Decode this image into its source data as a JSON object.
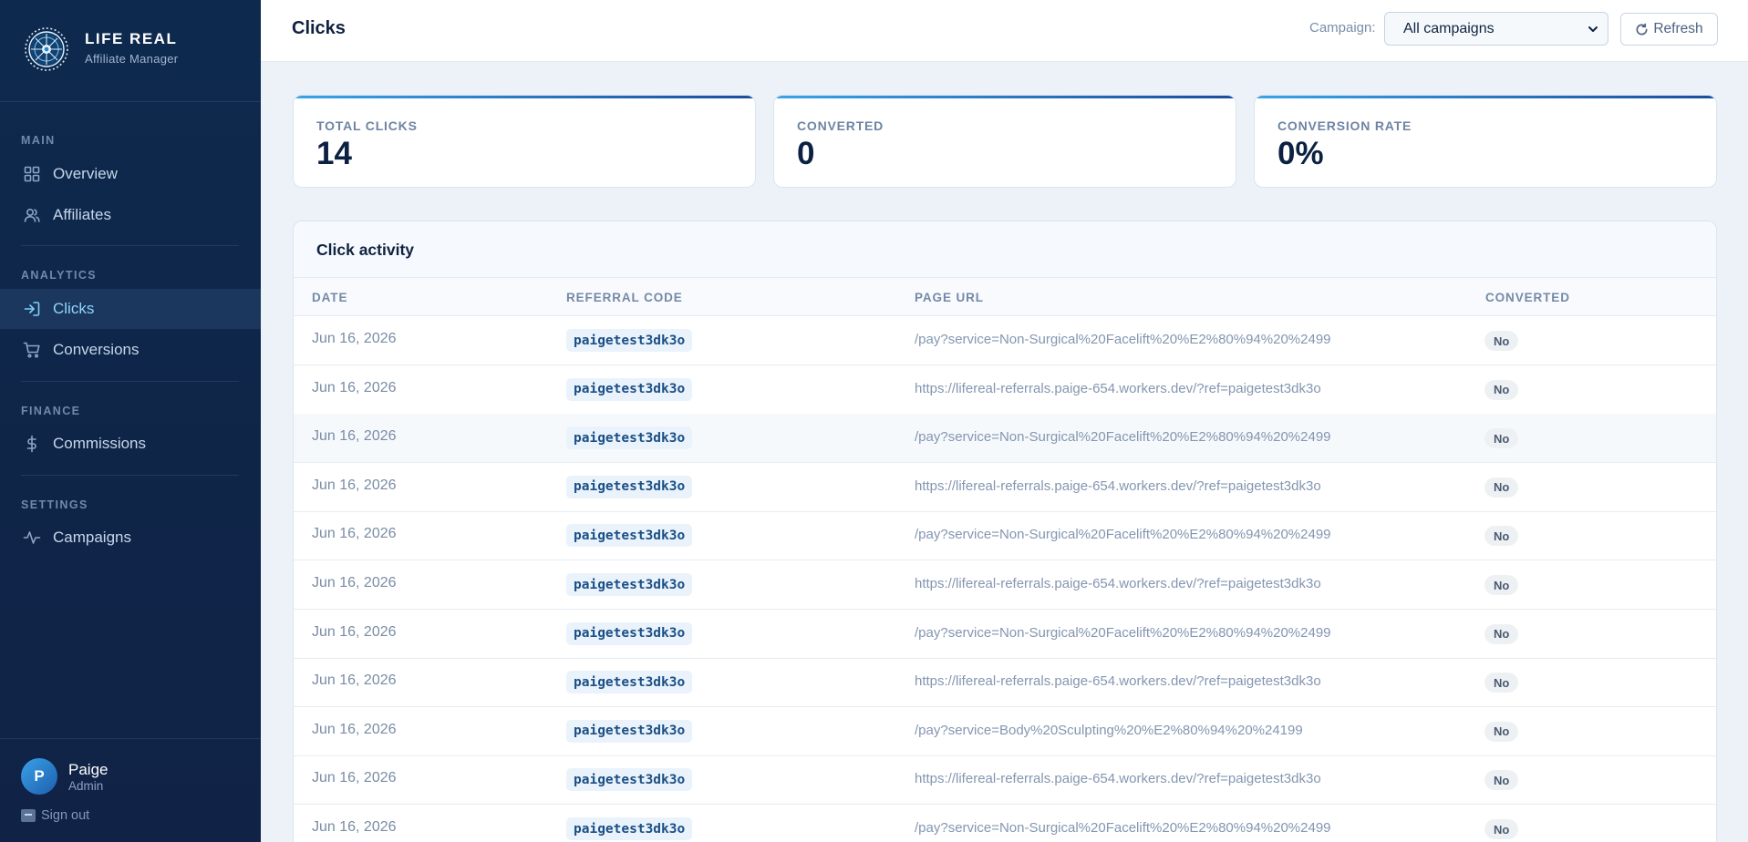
{
  "brand": {
    "name": "LIFE REAL",
    "subtitle": "Affiliate Manager"
  },
  "sidebar": {
    "sections": [
      {
        "label": "MAIN",
        "items": [
          {
            "label": "Overview",
            "icon": "grid-icon"
          },
          {
            "label": "Affiliates",
            "icon": "users-icon"
          }
        ]
      },
      {
        "label": "ANALYTICS",
        "items": [
          {
            "label": "Clicks",
            "icon": "login-arrow-icon",
            "active": true
          },
          {
            "label": "Conversions",
            "icon": "cart-icon"
          }
        ]
      },
      {
        "label": "FINANCE",
        "items": [
          {
            "label": "Commissions",
            "icon": "dollar-icon"
          }
        ]
      },
      {
        "label": "SETTINGS",
        "items": [
          {
            "label": "Campaigns",
            "icon": "activity-icon"
          }
        ]
      }
    ]
  },
  "user": {
    "initial": "P",
    "name": "Paige",
    "role": "Admin",
    "signout_label": "Sign out"
  },
  "header": {
    "title": "Clicks",
    "campaign_label": "Campaign:",
    "campaign_selected": "All campaigns",
    "refresh_label": "Refresh"
  },
  "stats": [
    {
      "label": "TOTAL CLICKS",
      "value": "14"
    },
    {
      "label": "CONVERTED",
      "value": "0"
    },
    {
      "label": "CONVERSION RATE",
      "value": "0%"
    }
  ],
  "table": {
    "title": "Click activity",
    "columns": [
      "DATE",
      "REFERRAL CODE",
      "PAGE URL",
      "CONVERTED"
    ],
    "rows": [
      {
        "date": "Jun 16, 2026",
        "code": "paigetest3dk3o",
        "url": "/pay?service=Non-Surgical%20Facelift%20%E2%80%94%20%2499",
        "converted": "No"
      },
      {
        "date": "Jun 16, 2026",
        "code": "paigetest3dk3o",
        "url": "https://lifereal-referrals.paige-654.workers.dev/?ref=paigetest3dk3o",
        "converted": "No"
      },
      {
        "date": "Jun 16, 2026",
        "code": "paigetest3dk3o",
        "url": "/pay?service=Non-Surgical%20Facelift%20%E2%80%94%20%2499",
        "converted": "No"
      },
      {
        "date": "Jun 16, 2026",
        "code": "paigetest3dk3o",
        "url": "https://lifereal-referrals.paige-654.workers.dev/?ref=paigetest3dk3o",
        "converted": "No"
      },
      {
        "date": "Jun 16, 2026",
        "code": "paigetest3dk3o",
        "url": "/pay?service=Non-Surgical%20Facelift%20%E2%80%94%20%2499",
        "converted": "No"
      },
      {
        "date": "Jun 16, 2026",
        "code": "paigetest3dk3o",
        "url": "https://lifereal-referrals.paige-654.workers.dev/?ref=paigetest3dk3o",
        "converted": "No"
      },
      {
        "date": "Jun 16, 2026",
        "code": "paigetest3dk3o",
        "url": "/pay?service=Non-Surgical%20Facelift%20%E2%80%94%20%2499",
        "converted": "No"
      },
      {
        "date": "Jun 16, 2026",
        "code": "paigetest3dk3o",
        "url": "https://lifereal-referrals.paige-654.workers.dev/?ref=paigetest3dk3o",
        "converted": "No"
      },
      {
        "date": "Jun 16, 2026",
        "code": "paigetest3dk3o",
        "url": "/pay?service=Body%20Sculpting%20%E2%80%94%20%24199",
        "converted": "No"
      },
      {
        "date": "Jun 16, 2026",
        "code": "paigetest3dk3o",
        "url": "https://lifereal-referrals.paige-654.workers.dev/?ref=paigetest3dk3o",
        "converted": "No"
      },
      {
        "date": "Jun 16, 2026",
        "code": "paigetest3dk3o",
        "url": "/pay?service=Non-Surgical%20Facelift%20%E2%80%94%20%2499",
        "converted": "No"
      }
    ]
  },
  "colors": {
    "sidebar_bg": "#0d2a4e",
    "accent": "#3aa4e6",
    "active_text": "#8fd6fb",
    "code_text": "#1b4f86"
  }
}
